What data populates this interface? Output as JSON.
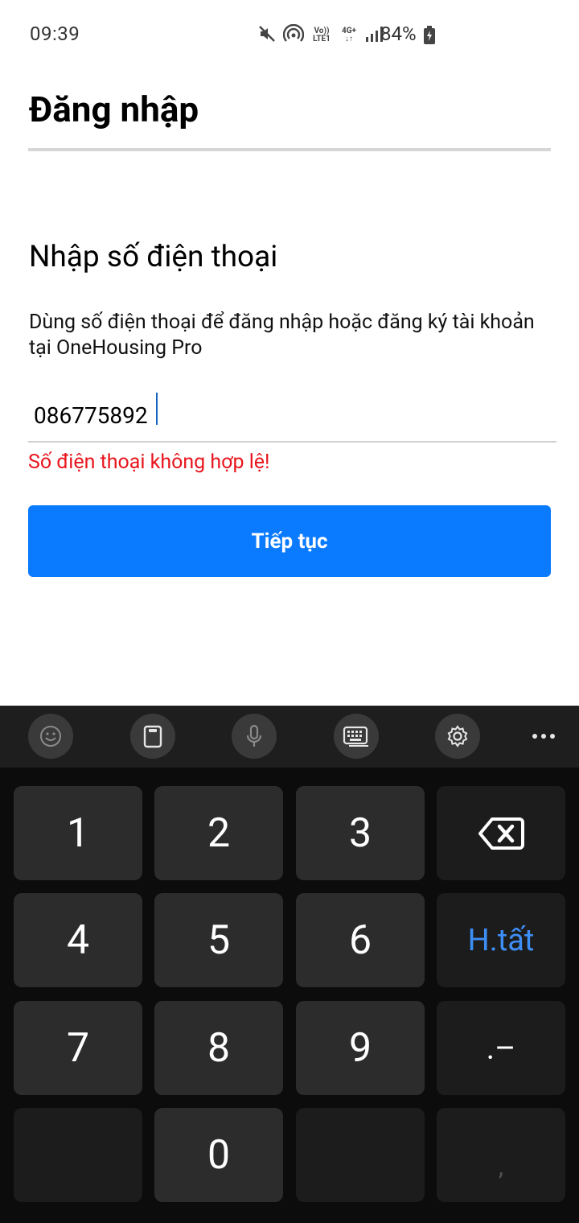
{
  "status_bar": {
    "time": "09:39",
    "battery_percent": "84%",
    "volte_label_top": "Vo))",
    "volte_label_bottom": "LTE1",
    "network_label": "4G+"
  },
  "header": {
    "title": "Đăng nhập"
  },
  "form": {
    "section_title": "Nhập số điện thoại",
    "description": "Dùng số điện thoại để đăng nhập hoặc đăng ký tài khoản tại OneHousing Pro",
    "phone_value": "086775892",
    "error_text": "Số điện thoại không hợp lệ!",
    "submit_label": "Tiếp tục"
  },
  "keyboard": {
    "toolbar": [
      "emoji-icon",
      "clipboard-icon",
      "mic-icon",
      "keyboard-icon",
      "settings-icon",
      "more-icon"
    ],
    "keys": {
      "k1": "1",
      "k2": "2",
      "k3": "3",
      "k4": "4",
      "k5": "5",
      "k6": "6",
      "k7": "7",
      "k8": "8",
      "k9": "9",
      "k0": "0",
      "done": "H.tất",
      "dot_dash": ".–",
      "comma": ","
    },
    "colors": {
      "done_accent": "#3d8ef6",
      "background": "#0c0c0c"
    }
  },
  "colors": {
    "primary": "#0a7aff",
    "error": "#e8141c"
  }
}
